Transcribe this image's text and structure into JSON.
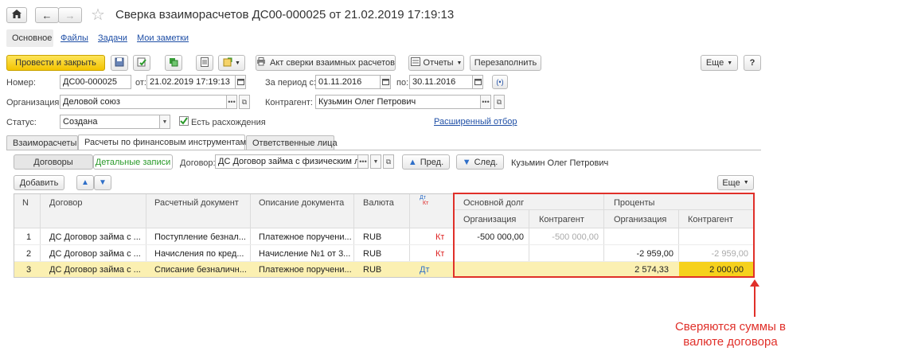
{
  "window": {
    "title": "Сверка взаиморасчетов ДС00-000025 от 21.02.2019 17:19:13",
    "favorite_icon": "star-icon"
  },
  "nav_tabs": [
    "Основное",
    "Файлы",
    "Задачи",
    "Мои заметки"
  ],
  "toolbar": {
    "post_close_label": "Провести и закрыть",
    "act_label": "Акт сверки взаимных расчетов",
    "reports_label": "Отчеты",
    "refill_label": "Перезаполнить",
    "more_label": "Еще",
    "help_label": "?"
  },
  "form": {
    "number_label": "Номер:",
    "number_value": "ДС00-000025",
    "from_label": "от:",
    "date_value": "21.02.2019 17:19:13",
    "period_label": "За период с:",
    "period_from": "01.11.2016",
    "period_to_label": "по:",
    "period_to": "30.11.2016",
    "org_label": "Организация:",
    "org_value": "Деловой союз",
    "counterparty_label": "Контрагент:",
    "counterparty_value": "Кузьмин Олег Петрович",
    "status_label": "Статус:",
    "status_value": "Создана",
    "discrepancy_label": "Есть расхождения",
    "extended_filter_link": "Расширенный отбор"
  },
  "doc_tabs": [
    "Взаиморасчеты",
    "Расчеты по финансовым инструментам (1)",
    "Ответственные лица"
  ],
  "subpanel": {
    "contracts_label": "Договоры",
    "details_label": "Детальные записи",
    "contract_label": "Договор:",
    "contract_value": "ДС Договор займа с физическим лицо",
    "prev_label": "Пред.",
    "next_label": "След.",
    "counterparty_text": "Кузьмин Олег Петрович",
    "add_label": "Добавить",
    "more_label": "Еще"
  },
  "table": {
    "headers": {
      "n": "N",
      "contract": "Договор",
      "doc": "Расчетный документ",
      "desc": "Описание документа",
      "currency": "Валюта",
      "dtkt_top": "Дт",
      "dtkt_bottom": "Кт",
      "principal": "Основной долг",
      "interest": "Проценты",
      "org": "Организация",
      "counterparty": "Контрагент"
    },
    "rows": [
      {
        "n": "1",
        "contract": "ДС Договор займа с ...",
        "doc": "Поступление безнал...",
        "desc": "Платежное поручени...",
        "currency": "RUB",
        "dk": "Кт",
        "p_org": "-500 000,00",
        "p_ctr": "-500 000,00",
        "i_org": "",
        "i_ctr": ""
      },
      {
        "n": "2",
        "contract": "ДС Договор займа с ...",
        "doc": "Начисления по кред...",
        "desc": "Начисление №1 от 3...",
        "currency": "RUB",
        "dk": "Кт",
        "p_org": "",
        "p_ctr": "",
        "i_org": "-2 959,00",
        "i_ctr": "-2 959,00"
      },
      {
        "n": "3",
        "contract": "ДС Договор займа с ...",
        "doc": "Списание безналичн...",
        "desc": "Платежное поручени...",
        "currency": "RUB",
        "dk": "Дт",
        "p_org": "",
        "p_ctr": "",
        "i_org": "2 574,33",
        "i_ctr": "2 000,00"
      }
    ]
  },
  "annotation": {
    "line1": "Сверяются суммы в",
    "line2": "валюте договора",
    "color": "#e0302a"
  }
}
